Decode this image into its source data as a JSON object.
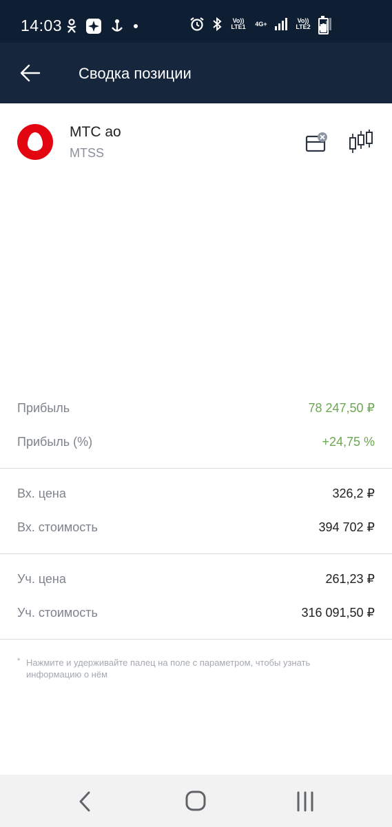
{
  "status_bar": {
    "time": "14:03",
    "sim1_label": "Vo)) LTE1",
    "network_label": "4G+",
    "sim2_label": "Vo)) LTE2",
    "icons": [
      "odnoklassniki-icon",
      "app-notification-icon",
      "alarm-icon",
      "bluetooth-icon",
      "signal-icon",
      "battery-icon"
    ]
  },
  "app_bar": {
    "title": "Сводка позиции",
    "background": "#15263d"
  },
  "instrument": {
    "name": "МТС ао",
    "ticker": "MTSS",
    "brand_color": "#e30611"
  },
  "metrics": {
    "profit": {
      "label": "Прибыль",
      "value": "78 247,50 ₽"
    },
    "profit_pct": {
      "label": "Прибыль (%)",
      "value": "+24,75 %"
    },
    "entry_price": {
      "label": "Вх. цена",
      "value": "326,2 ₽"
    },
    "entry_cost": {
      "label": "Вх. стоимость",
      "value": "394 702 ₽"
    },
    "book_price": {
      "label": "Уч. цена",
      "value": "261,23 ₽"
    },
    "book_cost": {
      "label": "Уч. стоимость",
      "value": "316 091,50 ₽"
    }
  },
  "footnote": {
    "star": "*",
    "text": "Нажмите и удерживайте палец на поле с параметром, чтобы узнать информацию о нём"
  },
  "colors": {
    "positive": "#6aa84f",
    "label": "#7d838c",
    "status_bar": "#0e1f33"
  }
}
